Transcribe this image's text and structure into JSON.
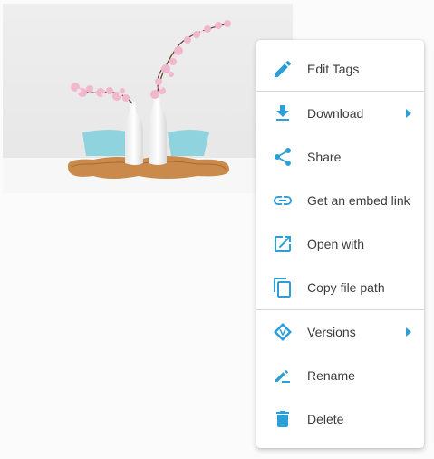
{
  "thumbnail": {
    "alt": "Two white vases with pink blossoms on a wooden tray"
  },
  "colors": {
    "accent": "#2e9fd6",
    "text": "#3c3c3c",
    "divider": "#d6d6d6"
  },
  "context_menu": {
    "items": [
      {
        "label": "Edit Tags",
        "icon": "pencil-icon",
        "submenu": false
      },
      {
        "label": "Download",
        "icon": "download-icon",
        "submenu": true
      },
      {
        "label": "Share",
        "icon": "share-icon",
        "submenu": false
      },
      {
        "label": "Get an embed link",
        "icon": "link-icon",
        "submenu": false
      },
      {
        "label": "Open with",
        "icon": "open-external-icon",
        "submenu": false
      },
      {
        "label": "Copy file path",
        "icon": "copy-icon",
        "submenu": false
      },
      {
        "label": "Versions",
        "icon": "versions-icon",
        "submenu": true
      },
      {
        "label": "Rename",
        "icon": "rename-icon",
        "submenu": false
      },
      {
        "label": "Delete",
        "icon": "trash-icon",
        "submenu": false
      }
    ]
  }
}
